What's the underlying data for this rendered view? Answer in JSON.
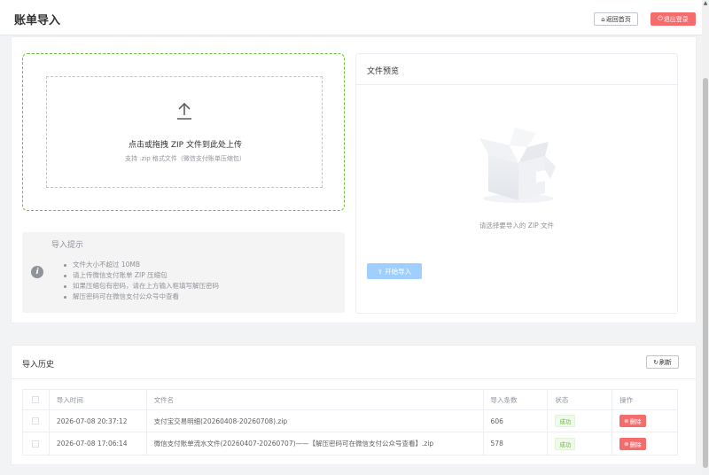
{
  "header": {
    "title": "账单导入",
    "home_label": "返回首页",
    "logout_label": "退出登录"
  },
  "upload": {
    "drop_text": "点击或拖拽 ZIP 文件到此处上传",
    "drop_sub": "支持 .zip 格式文件（微信支付账单压缩包）"
  },
  "tips": {
    "title": "导入提示",
    "items": [
      "文件大小不超过 10MB",
      "请上传微信支付账单 ZIP 压缩包",
      "如果压缩包有密码，请在上方输入框填写解压密码",
      "解压密码可在微信支付公众号中查看"
    ]
  },
  "preview": {
    "title": "文件预览",
    "empty_text": "请选择要导入的 ZIP 文件",
    "import_label": "开始导入"
  },
  "history": {
    "title": "导入历史",
    "refresh_label": "刷新",
    "columns": [
      "导入时间",
      "文件名",
      "导入条数",
      "状态",
      "操作"
    ],
    "rows": [
      {
        "time": "2026-07-08 20:37:12",
        "filename": "支付宝交易明细(20260408-20260708).zip",
        "count": "606",
        "status": "成功",
        "action": "删除"
      },
      {
        "time": "2026-07-08 17:06:14",
        "filename": "微信支付账单流水文件(20260407-20260707)——【解压密码可在微信支付公众号查看】.zip",
        "count": "578",
        "status": "成功",
        "action": "删除"
      }
    ]
  },
  "colors": {
    "primary": "#409eff",
    "success": "#67c23a",
    "danger": "#f56c6c"
  },
  "icons": {
    "home": "home-icon",
    "logout": "logout-icon",
    "upload": "upload-icon",
    "info": "info-icon",
    "refresh": "refresh-icon",
    "delete": "delete-icon",
    "empty": "empty-box-illustration"
  }
}
